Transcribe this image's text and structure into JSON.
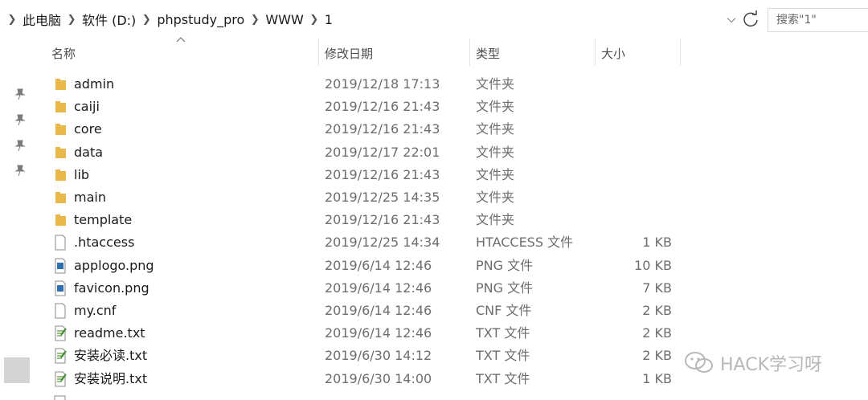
{
  "address_bar": {
    "crumbs": [
      "此电脑",
      "软件 (D:)",
      "phpstudy_pro",
      "WWW",
      "1"
    ],
    "search_placeholder": "搜索\"1\""
  },
  "columns": {
    "name": "名称",
    "date": "修改日期",
    "type": "类型",
    "size": "大小"
  },
  "files": [
    {
      "name": "admin",
      "date": "2019/12/18 17:13",
      "type": "文件夹",
      "size": "",
      "icon": "folder-icon"
    },
    {
      "name": "caiji",
      "date": "2019/12/16 21:43",
      "type": "文件夹",
      "size": "",
      "icon": "folder-icon"
    },
    {
      "name": "core",
      "date": "2019/12/16 21:43",
      "type": "文件夹",
      "size": "",
      "icon": "folder-icon"
    },
    {
      "name": "data",
      "date": "2019/12/17 22:01",
      "type": "文件夹",
      "size": "",
      "icon": "folder-icon"
    },
    {
      "name": "lib",
      "date": "2019/12/16 21:43",
      "type": "文件夹",
      "size": "",
      "icon": "folder-icon"
    },
    {
      "name": "main",
      "date": "2019/12/25 14:35",
      "type": "文件夹",
      "size": "",
      "icon": "folder-icon"
    },
    {
      "name": "template",
      "date": "2019/12/16 21:43",
      "type": "文件夹",
      "size": "",
      "icon": "folder-icon"
    },
    {
      "name": ".htaccess",
      "date": "2019/12/25 14:34",
      "type": "HTACCESS 文件",
      "size": "1 KB",
      "icon": "blank-file-icon"
    },
    {
      "name": "applogo.png",
      "date": "2019/6/14 12:46",
      "type": "PNG 文件",
      "size": "10 KB",
      "icon": "image-file-icon"
    },
    {
      "name": "favicon.png",
      "date": "2019/6/14 12:46",
      "type": "PNG 文件",
      "size": "7 KB",
      "icon": "image-file-icon"
    },
    {
      "name": "my.cnf",
      "date": "2019/6/14 12:46",
      "type": "CNF 文件",
      "size": "2 KB",
      "icon": "blank-file-icon"
    },
    {
      "name": "readme.txt",
      "date": "2019/6/14 12:46",
      "type": "TXT 文件",
      "size": "2 KB",
      "icon": "text-file-icon"
    },
    {
      "name": "安装必读.txt",
      "date": "2019/6/30 14:12",
      "type": "TXT 文件",
      "size": "2 KB",
      "icon": "text-file-icon"
    },
    {
      "name": "安装说明.txt",
      "date": "2019/6/30 14:00",
      "type": "TXT 文件",
      "size": "1 KB",
      "icon": "text-file-icon"
    }
  ],
  "watermark": {
    "text": "HACK学习呀",
    "icon": "wechat-logo"
  },
  "colors": {
    "folder": "#e8b84a",
    "header_text": "#4d4d4d",
    "secondary_text": "#6d6d6d"
  }
}
